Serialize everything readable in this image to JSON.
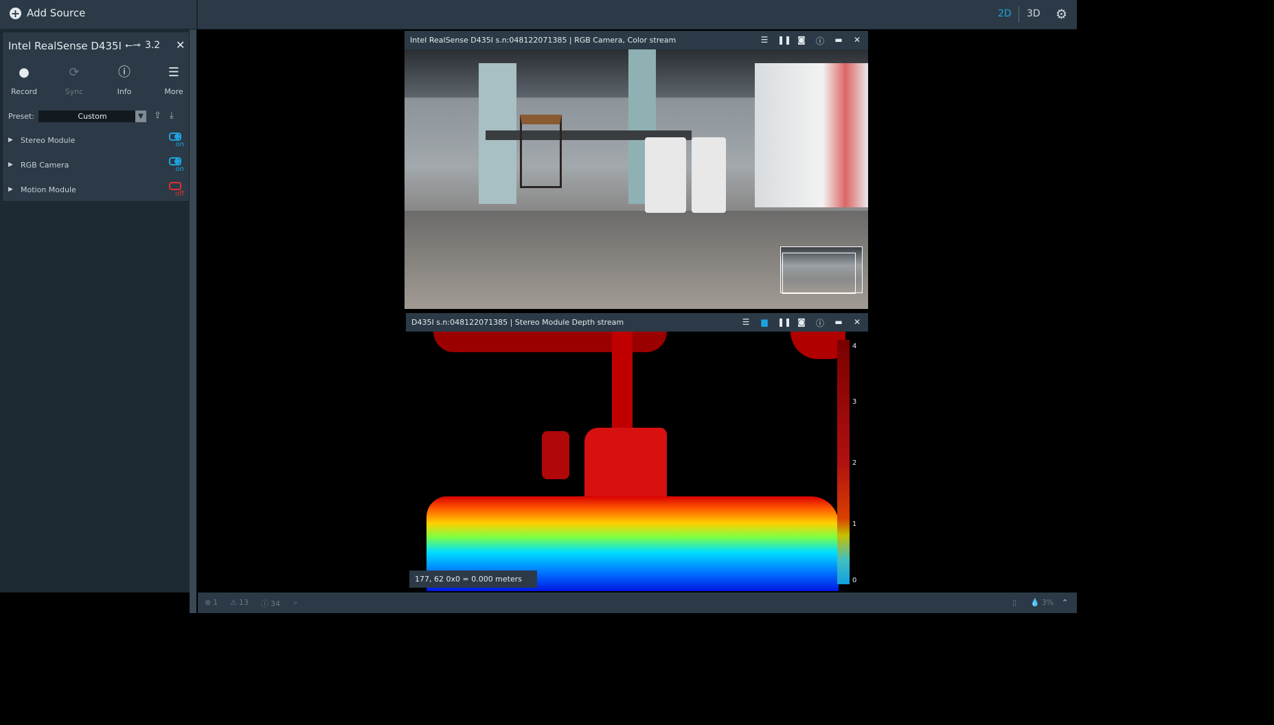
{
  "header": {
    "add_source_label": "Add Source",
    "mode_2d": "2D",
    "mode_3d": "3D",
    "accent_color": "#1fa3e0"
  },
  "device": {
    "name": "Intel RealSense D435I",
    "usb_version": "3.2",
    "tools": [
      {
        "label": "Record",
        "icon": "record-icon",
        "enabled": true
      },
      {
        "label": "Sync",
        "icon": "sync-icon",
        "enabled": false
      },
      {
        "label": "Info",
        "icon": "info-icon",
        "enabled": true
      },
      {
        "label": "More",
        "icon": "hamburger-icon",
        "enabled": true
      }
    ],
    "preset_label": "Preset:",
    "preset_value": "Custom",
    "modules": [
      {
        "name": "Stereo Module",
        "state": "on"
      },
      {
        "name": "RGB Camera",
        "state": "on"
      },
      {
        "name": "Motion Module",
        "state": "off"
      }
    ]
  },
  "streams": {
    "rgb": {
      "title": "Intel RealSense D435I s.n:048122071385 | RGB Camera, Color stream"
    },
    "depth": {
      "title": "D435I s.n:048122071385 | Stereo Module Depth stream",
      "colorbar_ticks": [
        "4",
        "3",
        "2",
        "1",
        "0"
      ],
      "readout": "177, 62 0x0 = 0.000 meters"
    }
  },
  "status": {
    "errors": "1",
    "warnings": "13",
    "info": "34",
    "cpu": "3%"
  }
}
